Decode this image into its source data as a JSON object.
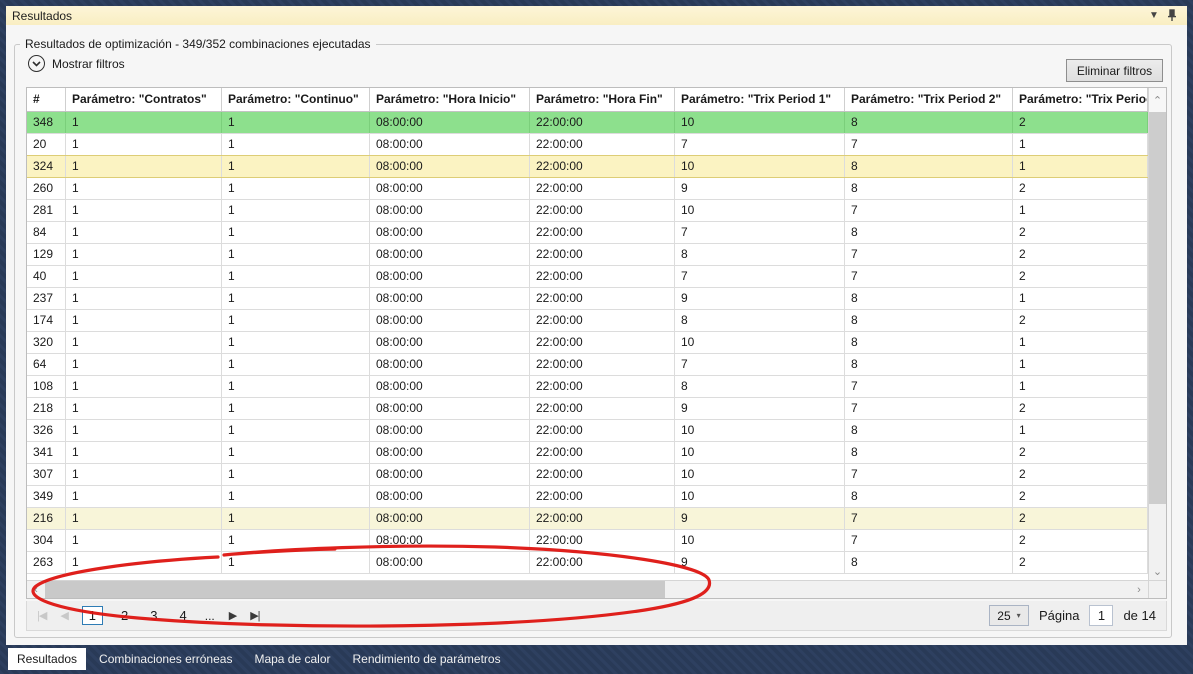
{
  "window": {
    "title": "Resultados",
    "collapse_icon": "▼",
    "pin_icon": "pin"
  },
  "header": {
    "groupbox_label": "Resultados de optimización - 349/352 combinaciones ejecutadas",
    "show_filters_label": "Mostrar filtros",
    "clear_filters_button": "Eliminar filtros"
  },
  "table": {
    "columns": [
      "#",
      "Parámetro: \"Contratos\"",
      "Parámetro: \"Continuo\"",
      "Parámetro: \"Hora Inicio\"",
      "Parámetro: \"Hora Fin\"",
      "Parámetro: \"Trix Period 1\"",
      "Parámetro: \"Trix Period 2\"",
      "Parámetro: \"Trix Perioc"
    ],
    "rows": [
      {
        "id": "348",
        "values": [
          "1",
          "1",
          "08:00:00",
          "22:00:00",
          "10",
          "8",
          "2"
        ],
        "highlight": "green"
      },
      {
        "id": "20",
        "values": [
          "1",
          "1",
          "08:00:00",
          "22:00:00",
          "7",
          "7",
          "1"
        ],
        "highlight": "none"
      },
      {
        "id": "324",
        "values": [
          "1",
          "1",
          "08:00:00",
          "22:00:00",
          "10",
          "8",
          "1"
        ],
        "highlight": "yellow-selected"
      },
      {
        "id": "260",
        "values": [
          "1",
          "1",
          "08:00:00",
          "22:00:00",
          "9",
          "8",
          "2"
        ],
        "highlight": "none"
      },
      {
        "id": "281",
        "values": [
          "1",
          "1",
          "08:00:00",
          "22:00:00",
          "10",
          "7",
          "1"
        ],
        "highlight": "none"
      },
      {
        "id": "84",
        "values": [
          "1",
          "1",
          "08:00:00",
          "22:00:00",
          "7",
          "8",
          "2"
        ],
        "highlight": "none"
      },
      {
        "id": "129",
        "values": [
          "1",
          "1",
          "08:00:00",
          "22:00:00",
          "8",
          "7",
          "2"
        ],
        "highlight": "none"
      },
      {
        "id": "40",
        "values": [
          "1",
          "1",
          "08:00:00",
          "22:00:00",
          "7",
          "7",
          "2"
        ],
        "highlight": "none"
      },
      {
        "id": "237",
        "values": [
          "1",
          "1",
          "08:00:00",
          "22:00:00",
          "9",
          "8",
          "1"
        ],
        "highlight": "none"
      },
      {
        "id": "174",
        "values": [
          "1",
          "1",
          "08:00:00",
          "22:00:00",
          "8",
          "8",
          "2"
        ],
        "highlight": "none"
      },
      {
        "id": "320",
        "values": [
          "1",
          "1",
          "08:00:00",
          "22:00:00",
          "10",
          "8",
          "1"
        ],
        "highlight": "none"
      },
      {
        "id": "64",
        "values": [
          "1",
          "1",
          "08:00:00",
          "22:00:00",
          "7",
          "8",
          "1"
        ],
        "highlight": "none"
      },
      {
        "id": "108",
        "values": [
          "1",
          "1",
          "08:00:00",
          "22:00:00",
          "8",
          "7",
          "1"
        ],
        "highlight": "none"
      },
      {
        "id": "218",
        "values": [
          "1",
          "1",
          "08:00:00",
          "22:00:00",
          "9",
          "7",
          "2"
        ],
        "highlight": "none"
      },
      {
        "id": "326",
        "values": [
          "1",
          "1",
          "08:00:00",
          "22:00:00",
          "10",
          "8",
          "1"
        ],
        "highlight": "none"
      },
      {
        "id": "341",
        "values": [
          "1",
          "1",
          "08:00:00",
          "22:00:00",
          "10",
          "8",
          "2"
        ],
        "highlight": "none"
      },
      {
        "id": "307",
        "values": [
          "1",
          "1",
          "08:00:00",
          "22:00:00",
          "10",
          "7",
          "2"
        ],
        "highlight": "none"
      },
      {
        "id": "349",
        "values": [
          "1",
          "1",
          "08:00:00",
          "22:00:00",
          "10",
          "8",
          "2"
        ],
        "highlight": "none"
      },
      {
        "id": "216",
        "values": [
          "1",
          "1",
          "08:00:00",
          "22:00:00",
          "9",
          "7",
          "2"
        ],
        "highlight": "yellow"
      },
      {
        "id": "304",
        "values": [
          "1",
          "1",
          "08:00:00",
          "22:00:00",
          "10",
          "7",
          "2"
        ],
        "highlight": "none"
      },
      {
        "id": "263",
        "values": [
          "1",
          "1",
          "08:00:00",
          "22:00:00",
          "9",
          "8",
          "2"
        ],
        "highlight": "none"
      }
    ]
  },
  "pagination": {
    "first_label": "|◀",
    "prev_label": "◀",
    "next_label": "▶",
    "last_label": "▶|",
    "pages": [
      "1",
      "2",
      "3",
      "4"
    ],
    "current_page": "1",
    "ellipsis": "...",
    "page_size": "25",
    "page_size_arrow": "▾",
    "page_label": "Página",
    "page_input_value": "1",
    "total_label": "de 14"
  },
  "scrollbars": {
    "up_arrow": "⌃",
    "down_arrow": "⌄",
    "left_arrow": "‹",
    "right_arrow": "›"
  },
  "tabs": [
    {
      "label": "Resultados",
      "active": true
    },
    {
      "label": "Combinaciones erróneas",
      "active": false
    },
    {
      "label": "Mapa de calor",
      "active": false
    },
    {
      "label": "Rendimiento de parámetros",
      "active": false
    }
  ],
  "colors": {
    "frame": "#293a57",
    "titlebar": "#fcf3ce",
    "row_green": "#8de08d",
    "row_yellow_selected": "#fbf3c2",
    "row_yellow": "#f8f5d9",
    "current_page_border": "#2e7cb5",
    "annotation_red": "#dd1410"
  }
}
